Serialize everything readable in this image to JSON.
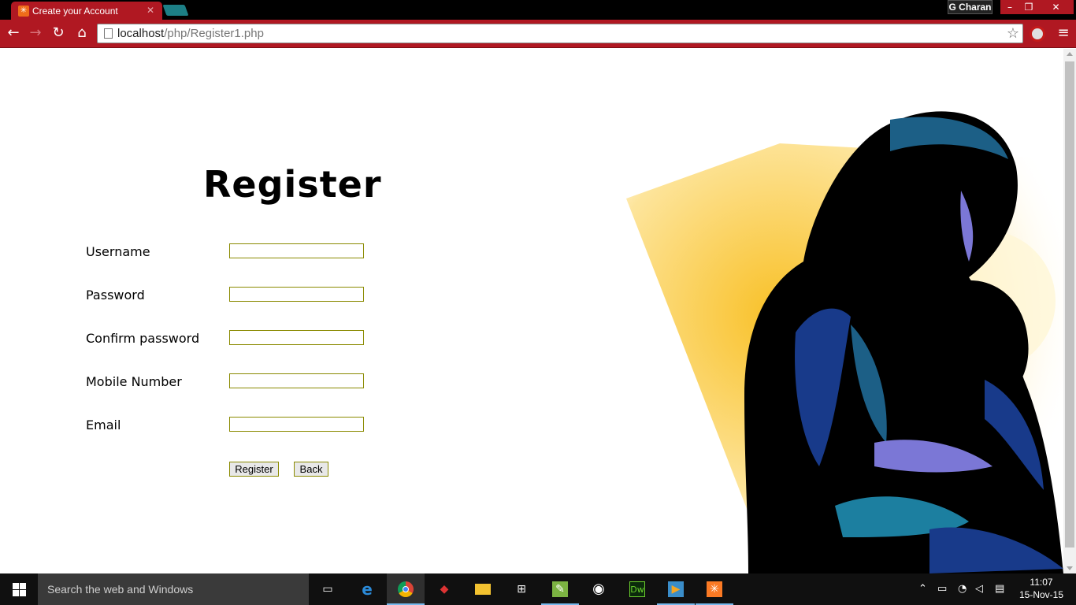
{
  "browser": {
    "tab_title": "Create your Account",
    "profile_name": "G Charan",
    "url_host": "localhost",
    "url_path": "/php/Register1.php"
  },
  "page": {
    "heading": "Register",
    "fields": [
      {
        "label": "Username",
        "value": ""
      },
      {
        "label": "Password",
        "value": ""
      },
      {
        "label": "Confirm password",
        "value": ""
      },
      {
        "label": "Mobile Number",
        "value": ""
      },
      {
        "label": "Email",
        "value": ""
      }
    ],
    "register_button": "Register",
    "back_button": "Back"
  },
  "taskbar": {
    "search_placeholder": "Search the web and Windows",
    "time": "11:07",
    "date": "15-Nov-15",
    "dreamweaver_label": "Dw"
  },
  "colors": {
    "chrome_red": "#b01822",
    "field_border": "#8a8a00"
  }
}
